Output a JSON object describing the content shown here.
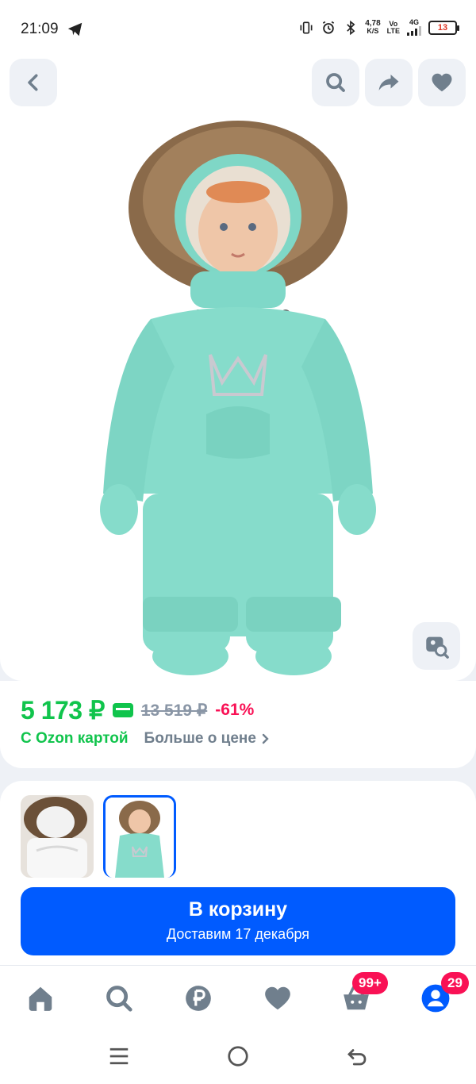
{
  "status": {
    "time": "21:09",
    "net_speed_top": "4,78",
    "net_speed_bottom": "K/S",
    "volte_top": "Vo",
    "volte_bottom": "LTE",
    "network": "4G",
    "battery": "13"
  },
  "gallery": {
    "back_icon": "chevron-left-icon",
    "search_icon": "search-icon",
    "share_icon": "share-icon",
    "favorite_icon": "heart-icon",
    "similar_icon": "similar-search-icon"
  },
  "price": {
    "current": "5 173 ₽",
    "old": "13 519 ₽",
    "discount": "-61%",
    "ozon_card_label": "С Ozon картой",
    "more_label": "Больше о цене",
    "accent_green": "#10c44c",
    "accent_pink": "#f91155"
  },
  "cart": {
    "title": "В корзину",
    "delivery": "Доставим 17 декабря",
    "color": "#005bff"
  },
  "bottom_nav": {
    "cart_badge": "99+",
    "profile_badge": "29"
  }
}
